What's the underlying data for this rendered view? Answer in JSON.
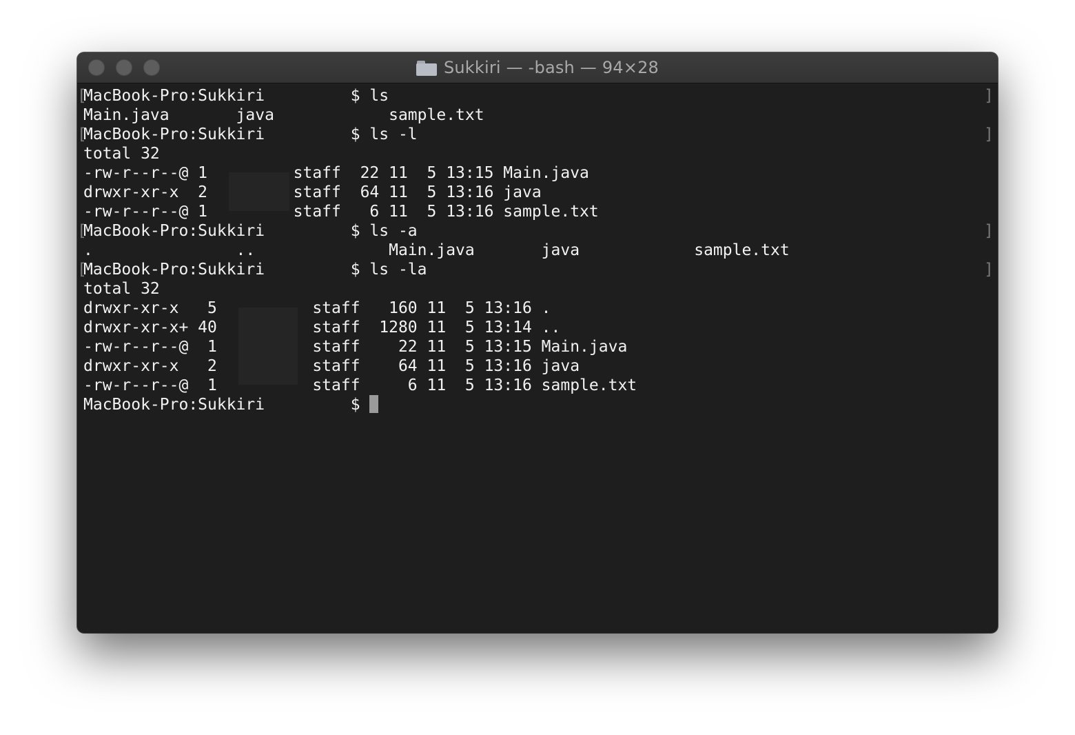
{
  "window": {
    "title": "Sukkiri — -bash — 94×28",
    "icon": "folder-icon"
  },
  "terminal": {
    "lines": [
      "MacBook-Pro:Sukkiri         $ ls",
      "Main.java       java            sample.txt",
      "MacBook-Pro:Sukkiri         $ ls -l",
      "total 32",
      "-rw-r--r--@ 1         staff  22 11  5 13:15 Main.java",
      "drwxr-xr-x  2         staff  64 11  5 13:16 java",
      "-rw-r--r--@ 1         staff   6 11  5 13:16 sample.txt",
      "MacBook-Pro:Sukkiri         $ ls -a",
      ".               ..              Main.java       java            sample.txt",
      "MacBook-Pro:Sukkiri         $ ls -la",
      "total 32",
      "drwxr-xr-x   5          staff   160 11  5 13:16 .",
      "drwxr-xr-x+ 40          staff  1280 11  5 13:14 ..",
      "-rw-r--r--@  1          staff    22 11  5 13:15 Main.java",
      "drwxr-xr-x   2          staff    64 11  5 13:16 java",
      "-rw-r--r--@  1          staff     6 11  5 13:16 sample.txt",
      "MacBook-Pro:Sukkiri         $ "
    ]
  }
}
